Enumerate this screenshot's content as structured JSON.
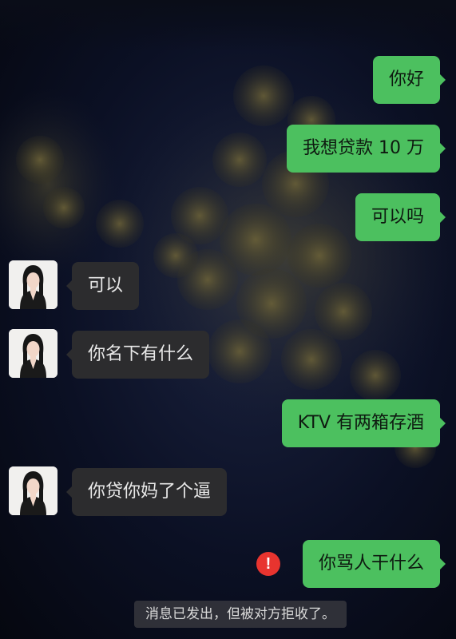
{
  "colors": {
    "outgoing_bubble": "#4cc05f",
    "incoming_bubble": "#2c2c2e",
    "error_badge": "#e8342f",
    "background": "#0b1024"
  },
  "messages": [
    {
      "direction": "out",
      "text": "你好"
    },
    {
      "direction": "out",
      "text": "我想贷款 10 万"
    },
    {
      "direction": "out",
      "text": "可以吗"
    },
    {
      "direction": "in",
      "text": "可以"
    },
    {
      "direction": "in",
      "text": "你名下有什么"
    },
    {
      "direction": "out",
      "text": "KTV 有两箱存酒"
    },
    {
      "direction": "in",
      "text": "你贷你妈了个逼"
    },
    {
      "direction": "out",
      "text": "你骂人干什么",
      "status": "rejected",
      "status_icon": "exclamation-error-icon"
    }
  ],
  "system_notice": "消息已发出，但被对方拒收了。",
  "icons": {
    "contact_avatar": "woman-portrait-avatar",
    "send_error": "exclamation-error-icon"
  }
}
